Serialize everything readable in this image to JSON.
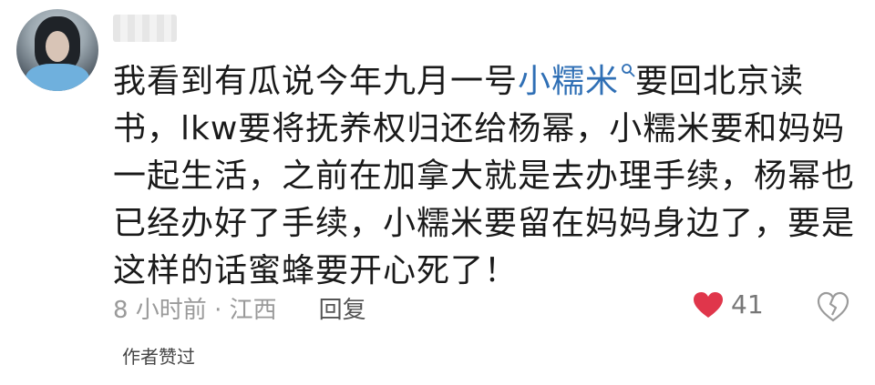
{
  "comment": {
    "lines": [
      {
        "pre": "我看到有瓜说今年九月一号",
        "link": "小糯米",
        "post": "要回北京读"
      },
      {
        "text": "书，lkw要将抚养权归还给杨幂，小糯米要和妈妈"
      },
      {
        "text": "一起生活，之前在加拿大就是去办理手续，杨幂也"
      },
      {
        "text": "已经办好了手续，小糯米要留在妈妈身边了，要是"
      },
      {
        "text": "这样的话蜜蜂要开心死了！"
      }
    ]
  },
  "meta": {
    "time_location": "8 小时前 · 江西",
    "reply_label": "回复"
  },
  "likes": {
    "count": "41",
    "heart_color": "#e0364b"
  },
  "author_liked": "作者赞过",
  "colors": {
    "link": "#2f6fb5"
  }
}
